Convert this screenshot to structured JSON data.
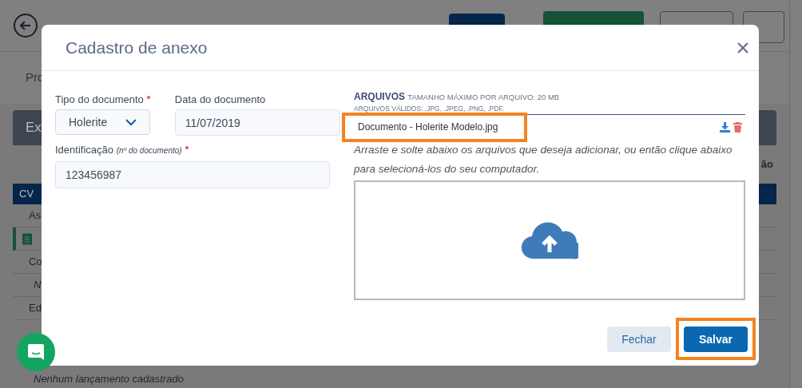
{
  "background": {
    "tab_fragment": "Pro",
    "card_fragment": "Ex",
    "table": {
      "header_fragment": "CV",
      "column_fragment": "ão",
      "rows": [
        {
          "kind": "text",
          "text": "As"
        },
        {
          "kind": "icon"
        },
        {
          "kind": "text",
          "text": "Co"
        },
        {
          "kind": "italic",
          "text": "N"
        },
        {
          "kind": "text",
          "text": "Ed"
        }
      ],
      "empty_text": "Nenhum lançamento cadastrado"
    }
  },
  "modal": {
    "title": "Cadastro de anexo",
    "doc_type": {
      "label": "Tipo do documento",
      "required": true,
      "value": "Holerite"
    },
    "doc_date": {
      "label": "Data do documento",
      "value": "11/07/2019"
    },
    "identification": {
      "label": "Identificação",
      "hint": "(nº do documento)",
      "required": true,
      "value": "123456987"
    },
    "files": {
      "title": "ARQUIVOS",
      "max_size": "TAMANHO MÁXIMO POR ARQUIVO: 20 MB",
      "valid_types": "ARQUIVOS VÁLIDOS: .JPG, .JPEG, .PNG, .PDF.",
      "items": [
        {
          "name": "Documento - Holerite Modelo.jpg",
          "highlighted": true
        }
      ],
      "instructions": "Arraste e solte abaixo os arquivos que deseja adicionar, ou então clique abaixo para selecioná-los do seu computador."
    },
    "buttons": [
      {
        "label": "Fechar",
        "kind": "secondary",
        "highlighted": false
      },
      {
        "label": "Salvar",
        "kind": "primary",
        "highlighted": true
      }
    ]
  }
}
